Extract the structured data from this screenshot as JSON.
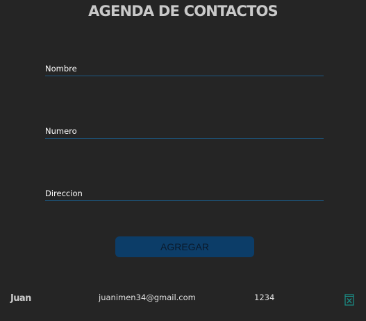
{
  "page": {
    "title": "AGENDA DE CONTACTOS"
  },
  "form": {
    "fields": [
      {
        "name": "nombre",
        "placeholder": "Nombre",
        "value": ""
      },
      {
        "name": "numero",
        "placeholder": "Numero",
        "value": ""
      },
      {
        "name": "direccion",
        "placeholder": "Direccion",
        "value": ""
      }
    ],
    "submit_label": "AGREGAR"
  },
  "contacts": [
    {
      "name": "Juan",
      "email": "juanimen34@gmail.com",
      "phone": "1234",
      "delete_icon": "delete-icon"
    }
  ],
  "colors": {
    "background": "#252525",
    "title": "#c9c9c9",
    "field_underline": "#1b5a86",
    "button_bg": "#0c3d68",
    "button_text": "#0a1a2c",
    "delete_icon": "#1a8a82"
  }
}
